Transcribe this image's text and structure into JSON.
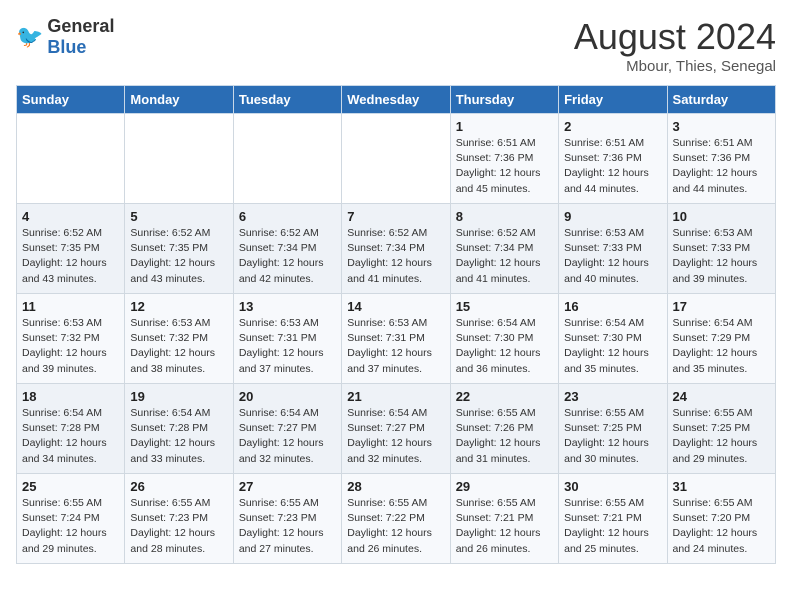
{
  "header": {
    "logo_general": "General",
    "logo_blue": "Blue",
    "month": "August 2024",
    "location": "Mbour, Thies, Senegal"
  },
  "days_of_week": [
    "Sunday",
    "Monday",
    "Tuesday",
    "Wednesday",
    "Thursday",
    "Friday",
    "Saturday"
  ],
  "weeks": [
    [
      {
        "day": "",
        "sunrise": "",
        "sunset": "",
        "daylight": ""
      },
      {
        "day": "",
        "sunrise": "",
        "sunset": "",
        "daylight": ""
      },
      {
        "day": "",
        "sunrise": "",
        "sunset": "",
        "daylight": ""
      },
      {
        "day": "",
        "sunrise": "",
        "sunset": "",
        "daylight": ""
      },
      {
        "day": "1",
        "sunrise": "Sunrise: 6:51 AM",
        "sunset": "Sunset: 7:36 PM",
        "daylight": "Daylight: 12 hours and 45 minutes."
      },
      {
        "day": "2",
        "sunrise": "Sunrise: 6:51 AM",
        "sunset": "Sunset: 7:36 PM",
        "daylight": "Daylight: 12 hours and 44 minutes."
      },
      {
        "day": "3",
        "sunrise": "Sunrise: 6:51 AM",
        "sunset": "Sunset: 7:36 PM",
        "daylight": "Daylight: 12 hours and 44 minutes."
      }
    ],
    [
      {
        "day": "4",
        "sunrise": "Sunrise: 6:52 AM",
        "sunset": "Sunset: 7:35 PM",
        "daylight": "Daylight: 12 hours and 43 minutes."
      },
      {
        "day": "5",
        "sunrise": "Sunrise: 6:52 AM",
        "sunset": "Sunset: 7:35 PM",
        "daylight": "Daylight: 12 hours and 43 minutes."
      },
      {
        "day": "6",
        "sunrise": "Sunrise: 6:52 AM",
        "sunset": "Sunset: 7:34 PM",
        "daylight": "Daylight: 12 hours and 42 minutes."
      },
      {
        "day": "7",
        "sunrise": "Sunrise: 6:52 AM",
        "sunset": "Sunset: 7:34 PM",
        "daylight": "Daylight: 12 hours and 41 minutes."
      },
      {
        "day": "8",
        "sunrise": "Sunrise: 6:52 AM",
        "sunset": "Sunset: 7:34 PM",
        "daylight": "Daylight: 12 hours and 41 minutes."
      },
      {
        "day": "9",
        "sunrise": "Sunrise: 6:53 AM",
        "sunset": "Sunset: 7:33 PM",
        "daylight": "Daylight: 12 hours and 40 minutes."
      },
      {
        "day": "10",
        "sunrise": "Sunrise: 6:53 AM",
        "sunset": "Sunset: 7:33 PM",
        "daylight": "Daylight: 12 hours and 39 minutes."
      }
    ],
    [
      {
        "day": "11",
        "sunrise": "Sunrise: 6:53 AM",
        "sunset": "Sunset: 7:32 PM",
        "daylight": "Daylight: 12 hours and 39 minutes."
      },
      {
        "day": "12",
        "sunrise": "Sunrise: 6:53 AM",
        "sunset": "Sunset: 7:32 PM",
        "daylight": "Daylight: 12 hours and 38 minutes."
      },
      {
        "day": "13",
        "sunrise": "Sunrise: 6:53 AM",
        "sunset": "Sunset: 7:31 PM",
        "daylight": "Daylight: 12 hours and 37 minutes."
      },
      {
        "day": "14",
        "sunrise": "Sunrise: 6:53 AM",
        "sunset": "Sunset: 7:31 PM",
        "daylight": "Daylight: 12 hours and 37 minutes."
      },
      {
        "day": "15",
        "sunrise": "Sunrise: 6:54 AM",
        "sunset": "Sunset: 7:30 PM",
        "daylight": "Daylight: 12 hours and 36 minutes."
      },
      {
        "day": "16",
        "sunrise": "Sunrise: 6:54 AM",
        "sunset": "Sunset: 7:30 PM",
        "daylight": "Daylight: 12 hours and 35 minutes."
      },
      {
        "day": "17",
        "sunrise": "Sunrise: 6:54 AM",
        "sunset": "Sunset: 7:29 PM",
        "daylight": "Daylight: 12 hours and 35 minutes."
      }
    ],
    [
      {
        "day": "18",
        "sunrise": "Sunrise: 6:54 AM",
        "sunset": "Sunset: 7:28 PM",
        "daylight": "Daylight: 12 hours and 34 minutes."
      },
      {
        "day": "19",
        "sunrise": "Sunrise: 6:54 AM",
        "sunset": "Sunset: 7:28 PM",
        "daylight": "Daylight: 12 hours and 33 minutes."
      },
      {
        "day": "20",
        "sunrise": "Sunrise: 6:54 AM",
        "sunset": "Sunset: 7:27 PM",
        "daylight": "Daylight: 12 hours and 32 minutes."
      },
      {
        "day": "21",
        "sunrise": "Sunrise: 6:54 AM",
        "sunset": "Sunset: 7:27 PM",
        "daylight": "Daylight: 12 hours and 32 minutes."
      },
      {
        "day": "22",
        "sunrise": "Sunrise: 6:55 AM",
        "sunset": "Sunset: 7:26 PM",
        "daylight": "Daylight: 12 hours and 31 minutes."
      },
      {
        "day": "23",
        "sunrise": "Sunrise: 6:55 AM",
        "sunset": "Sunset: 7:25 PM",
        "daylight": "Daylight: 12 hours and 30 minutes."
      },
      {
        "day": "24",
        "sunrise": "Sunrise: 6:55 AM",
        "sunset": "Sunset: 7:25 PM",
        "daylight": "Daylight: 12 hours and 29 minutes."
      }
    ],
    [
      {
        "day": "25",
        "sunrise": "Sunrise: 6:55 AM",
        "sunset": "Sunset: 7:24 PM",
        "daylight": "Daylight: 12 hours and 29 minutes."
      },
      {
        "day": "26",
        "sunrise": "Sunrise: 6:55 AM",
        "sunset": "Sunset: 7:23 PM",
        "daylight": "Daylight: 12 hours and 28 minutes."
      },
      {
        "day": "27",
        "sunrise": "Sunrise: 6:55 AM",
        "sunset": "Sunset: 7:23 PM",
        "daylight": "Daylight: 12 hours and 27 minutes."
      },
      {
        "day": "28",
        "sunrise": "Sunrise: 6:55 AM",
        "sunset": "Sunset: 7:22 PM",
        "daylight": "Daylight: 12 hours and 26 minutes."
      },
      {
        "day": "29",
        "sunrise": "Sunrise: 6:55 AM",
        "sunset": "Sunset: 7:21 PM",
        "daylight": "Daylight: 12 hours and 26 minutes."
      },
      {
        "day": "30",
        "sunrise": "Sunrise: 6:55 AM",
        "sunset": "Sunset: 7:21 PM",
        "daylight": "Daylight: 12 hours and 25 minutes."
      },
      {
        "day": "31",
        "sunrise": "Sunrise: 6:55 AM",
        "sunset": "Sunset: 7:20 PM",
        "daylight": "Daylight: 12 hours and 24 minutes."
      }
    ]
  ]
}
